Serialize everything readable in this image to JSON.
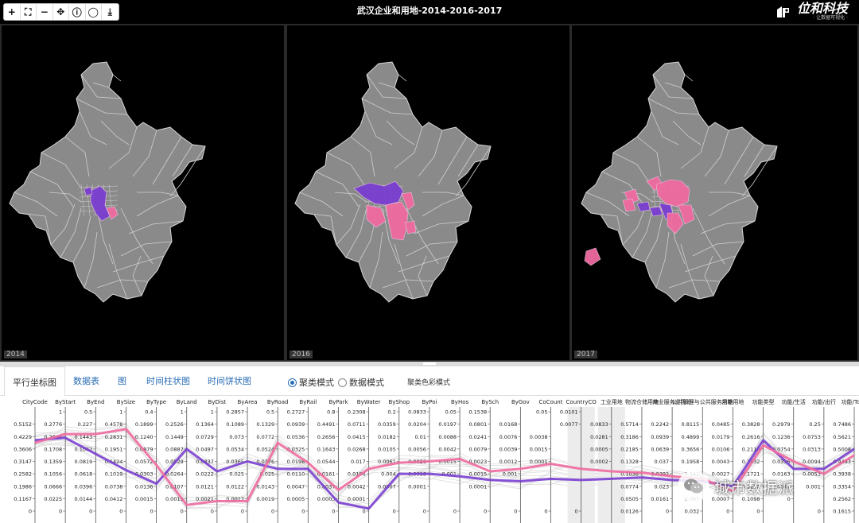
{
  "window": {
    "title": "武汉企业和用地-2014-2016-2017"
  },
  "toolbar": {
    "buttons": [
      {
        "name": "zoom-in",
        "glyph": "+"
      },
      {
        "name": "full-extent",
        "glyph": "⛶"
      },
      {
        "name": "zoom-out",
        "glyph": "−"
      },
      {
        "name": "pan",
        "glyph": "✥"
      },
      {
        "name": "info",
        "glyph": "ⓘ"
      },
      {
        "name": "select",
        "glyph": "◯"
      },
      {
        "name": "download",
        "glyph": "⤓"
      }
    ]
  },
  "logo": {
    "text": "位和科技",
    "sub": "· 让数据可视化 ·"
  },
  "maps": [
    {
      "year": "2014"
    },
    {
      "year": "2016"
    },
    {
      "year": "2017"
    }
  ],
  "tabs": [
    {
      "label": "平行坐标图",
      "active": true
    },
    {
      "label": "数据表",
      "active": false
    },
    {
      "label": "图",
      "active": false
    },
    {
      "label": "时间柱状图",
      "active": false
    },
    {
      "label": "时间饼状图",
      "active": false
    }
  ],
  "modes": [
    {
      "label": "聚类模式",
      "selected": true
    },
    {
      "label": "数据模式",
      "selected": false
    }
  ],
  "color_mode_label": "聚类色彩模式",
  "colors": {
    "purple": "#7a3fd0",
    "pink": "#f06aa0",
    "map_gray": "#8a8a8a",
    "link": "#2a6db5"
  },
  "pcp": {
    "axes": [
      {
        "header": "CityCode",
        "ticks": [
          "",
          "0.5152",
          "0.4229",
          "0.3606",
          "0.3147",
          "0.2582",
          "0.1986",
          "0.1167",
          "0"
        ]
      },
      {
        "header": "ByStart",
        "ticks": [
          "1",
          "0.2776",
          "0.2098",
          "0.1708",
          "0.1359",
          "0.1056",
          "0.0666",
          "0.0225",
          "0"
        ]
      },
      {
        "header": "ByEnd",
        "ticks": [
          "0.5",
          "0.227",
          "0.1443",
          "0.1062",
          "0.0819",
          "0.0618",
          "0.0396",
          "0.0144",
          "0"
        ]
      },
      {
        "header": "BySize",
        "ticks": [
          "1",
          "0.4578",
          "0.2831",
          "0.1951",
          "0.1424",
          "0.1019",
          "0.0738",
          "0.0412",
          "0"
        ]
      },
      {
        "header": "ByType",
        "ticks": [
          "0.4",
          "0.1899",
          "0.1240",
          "0.0879",
          "0.0572",
          "0.0303",
          "0.0136",
          "0.0015",
          "0"
        ]
      },
      {
        "header": "ByLand",
        "ticks": [
          "1",
          "0.2526",
          "0.1449",
          "0.0887",
          "0.0529",
          "0.0264",
          "0.0107",
          "0.0019",
          "0"
        ]
      },
      {
        "header": "ByDist",
        "ticks": [
          "1",
          "0.1364",
          "0.0729",
          "0.0497",
          "0.0337",
          "0.0222",
          "0.0121",
          "0.0021",
          "0"
        ]
      },
      {
        "header": "ByArea",
        "ticks": [
          "0.2857",
          "0.1089",
          "0.073",
          "0.0534",
          "0.0365",
          "0.025",
          "0.0122",
          "0.0017",
          "0"
        ]
      },
      {
        "header": "ByRoad",
        "ticks": [
          "0.5",
          "0.1329",
          "0.0772",
          "0.0524",
          "0.0376",
          "0.025",
          "0.0143",
          "0.0019",
          "0"
        ]
      },
      {
        "header": "ByRail",
        "ticks": [
          "0.2727",
          "0.0939",
          "0.0536",
          "0.0325",
          "0.0198",
          "0.0110",
          "0.0047",
          "0.0005",
          "0"
        ]
      },
      {
        "header": "ByPark",
        "ticks": [
          "0.8",
          "0.4491",
          "0.2656",
          "0.1643",
          "0.0544",
          "0.0161",
          "0.0037",
          "0.0003",
          "0"
        ]
      },
      {
        "header": "ByWater",
        "ticks": [
          "0.2308",
          "0.0711",
          "0.0415",
          "0.0268",
          "0.017",
          "0.0106",
          "0.0042",
          "0.0001",
          "0"
        ]
      },
      {
        "header": "ByShop",
        "ticks": [
          "0.2",
          "0.0359",
          "0.0182",
          "0.0105",
          "0.0061",
          "0.004",
          "0.0007",
          "",
          "0"
        ]
      },
      {
        "header": "ByPoi",
        "ticks": [
          "0.0833",
          "0.0204",
          "0.01",
          "0.0056",
          "0.0026",
          "0.0018",
          "0.0001",
          "",
          "0"
        ]
      },
      {
        "header": "ByHos",
        "ticks": [
          "0.05",
          "0.0197",
          "0.0088",
          "0.0042",
          "0.0015",
          "0.001",
          "",
          "",
          "0"
        ]
      },
      {
        "header": "BySch",
        "ticks": [
          "0.1538",
          "0.0801",
          "0.0241",
          "0.0079",
          "0.0023",
          "0.0015",
          "0.0001",
          "",
          "0"
        ]
      },
      {
        "header": "ByGov",
        "ticks": [
          "",
          "0.0168",
          "0.0076",
          "0.0039",
          "0.0012",
          "0.001",
          "",
          "",
          "0"
        ]
      },
      {
        "header": "CoCount",
        "ticks": [
          "0.05",
          "",
          "0.0038",
          "0.0015",
          "0.0001",
          "",
          "",
          "",
          "0"
        ]
      },
      {
        "header": "CountryCO",
        "ticks": [
          "0.0101",
          "0.0077",
          "",
          "",
          "",
          "",
          "",
          "",
          "0"
        ]
      },
      {
        "header": "工业用地",
        "ticks": [
          "",
          "0.0833",
          "0.0281",
          "0.0005",
          "0.0002",
          "",
          "",
          "",
          ""
        ]
      },
      {
        "header": "物流仓储用地",
        "ticks": [
          "",
          "0.5714",
          "0.3186",
          "0.2185",
          "0.1328",
          "0.1036",
          "0.0774",
          "0.0505",
          "0.0126"
        ]
      },
      {
        "header": "商业服务业用地",
        "ticks": [
          "",
          "0.2242",
          "0.0939",
          "0.0639",
          "0.037",
          "0.0292",
          "0.023",
          "0.0161",
          "0"
        ]
      },
      {
        "header": "公共管理与公共服务用地",
        "ticks": [
          "",
          "0.8115",
          "0.4899",
          "0.3656",
          "0.1958",
          "0.141",
          "0.112",
          "0.087",
          "0.032"
        ]
      },
      {
        "header": "功能用地",
        "ticks": [
          "",
          "0.0485",
          "0.0179",
          "0.0106",
          "0.0043",
          "0.0027",
          "",
          "0.0007",
          "0"
        ]
      },
      {
        "header": "功能类型",
        "ticks": [
          "",
          "0.3828",
          "0.2616",
          "0.2116",
          "0.1932",
          "0.1721",
          "0.1272",
          "0.1098",
          "0"
        ]
      },
      {
        "header": "功能/生活",
        "ticks": [
          "",
          "0.2979",
          "0.1236",
          "0.0754",
          "0.0336",
          "0.0163",
          "0.0047",
          "0",
          ""
        ]
      },
      {
        "header": "功能/出行",
        "ticks": [
          "",
          "0.25",
          "0.0753",
          "0.0313",
          "0.0094",
          "0.0053",
          "0.001",
          "",
          "0"
        ]
      },
      {
        "header": "功能/Total",
        "ticks": [
          "",
          "0.7486",
          "0.5621",
          "0.5008",
          "0.4483",
          "0.3938",
          "0.3354",
          "0.2562",
          "0.1615"
        ]
      }
    ],
    "series": [
      {
        "name": "cluster-purple",
        "color": "#7a3fd0",
        "levels": [
          2.3,
          2.1,
          3.4,
          4.7,
          5.8,
          3.0,
          4.8,
          4.0,
          4.6,
          4.6,
          7.3,
          7.8,
          5.0,
          5.0,
          5.2,
          5.5,
          5.6,
          5.4,
          5.5,
          5.4,
          5.3,
          5.5,
          5.6,
          6.0,
          2.3,
          4.6,
          4.6,
          3.0
        ]
      },
      {
        "name": "cluster-pink",
        "color": "#f06aa0",
        "levels": [
          2.5,
          1.8,
          1.8,
          1.4,
          4.3,
          7.5,
          7.2,
          7.2,
          2.5,
          4.1,
          6.3,
          4.6,
          4.1,
          4.0,
          3.8,
          4.8,
          4.6,
          4.2,
          4.6,
          4.8,
          4.9,
          5.2,
          5.4,
          6.4,
          2.7,
          4.0,
          5.0,
          3.5
        ]
      }
    ]
  },
  "watermark": {
    "text": "城市数据派"
  }
}
